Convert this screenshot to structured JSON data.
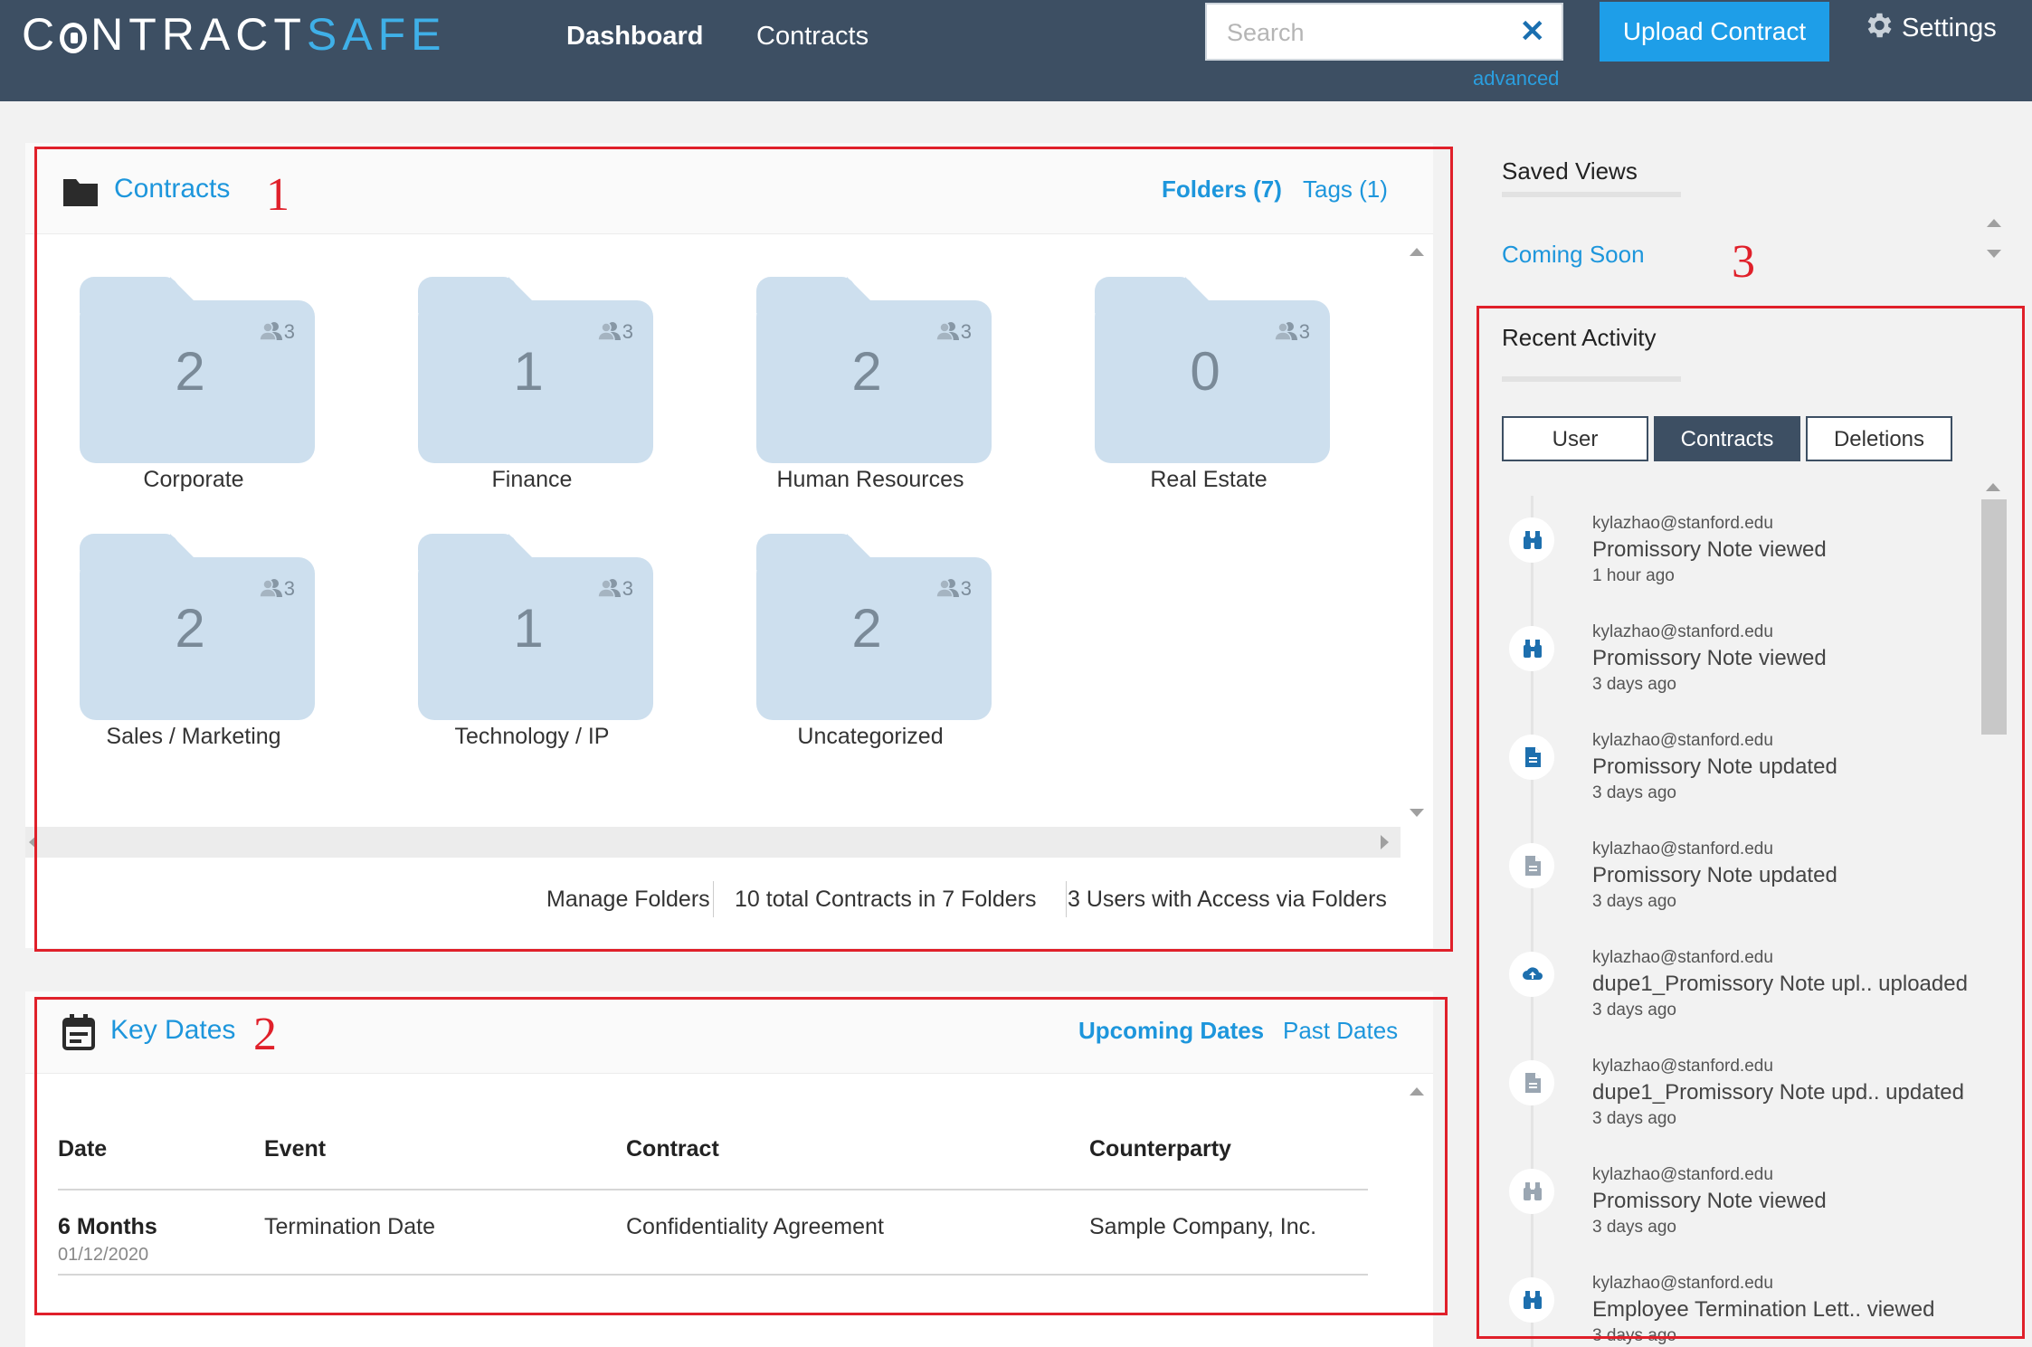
{
  "header": {
    "logo_main": "C NTRACT",
    "logo_accent": "SAFE",
    "nav": [
      "Dashboard",
      "Contracts"
    ],
    "search_placeholder": "Search",
    "search_clear": "✕",
    "advanced_link": "advanced",
    "upload_button": "Upload Contract",
    "settings": "Settings"
  },
  "annotations": [
    "1",
    "2",
    "3"
  ],
  "contracts_panel": {
    "title": "Contracts",
    "folders_tab": "Folders (7)",
    "tags_tab": "Tags (1)",
    "folders": [
      {
        "name": "Corporate",
        "count": "2",
        "users": "3"
      },
      {
        "name": "Finance",
        "count": "1",
        "users": "3"
      },
      {
        "name": "Human Resources",
        "count": "2",
        "users": "3"
      },
      {
        "name": "Real Estate",
        "count": "0",
        "users": "3"
      },
      {
        "name": "Sales / Marketing",
        "count": "2",
        "users": "3"
      },
      {
        "name": "Technology / IP",
        "count": "1",
        "users": "3"
      },
      {
        "name": "Uncategorized",
        "count": "2",
        "users": "3"
      }
    ],
    "footer": {
      "manage_folders": "Manage Folders",
      "total_contracts": "10 total Contracts in 7 Folders",
      "users_access": "3 Users with Access via Folders"
    }
  },
  "key_dates_panel": {
    "title": "Key Dates",
    "upcoming_tab": "Upcoming Dates",
    "past_tab": "Past Dates",
    "columns": [
      "Date",
      "Event",
      "Contract",
      "Counterparty"
    ],
    "rows": [
      {
        "date": "6 Months",
        "date_sub": "01/12/2020",
        "event": "Termination Date",
        "contract": "Confidentiality Agreement",
        "counterparty": "Sample Company, Inc."
      }
    ]
  },
  "sidebar": {
    "saved_views_title": "Saved Views",
    "coming_soon": "Coming Soon",
    "recent_activity_title": "Recent Activity",
    "tabs": [
      "User",
      "Contracts",
      "Deletions"
    ],
    "active_tab": "Contracts",
    "activity": [
      {
        "icon": "binoculars-icon",
        "user": "kylazhao@stanford.edu",
        "message": "Promissory Note viewed",
        "time": "1 hour ago"
      },
      {
        "icon": "binoculars-icon",
        "user": "kylazhao@stanford.edu",
        "message": "Promissory Note viewed",
        "time": "3 days ago"
      },
      {
        "icon": "document-icon",
        "user": "kylazhao@stanford.edu",
        "message": "Promissory Note updated",
        "time": "3 days ago"
      },
      {
        "icon": "document-icon",
        "user": "kylazhao@stanford.edu",
        "message": "Promissory Note updated",
        "time": "3 days ago"
      },
      {
        "icon": "cloud-upload-icon",
        "user": "kylazhao@stanford.edu",
        "message": "dupe1_Promissory Note upl.. uploaded",
        "time": "3 days ago"
      },
      {
        "icon": "document-icon",
        "user": "kylazhao@stanford.edu",
        "message": "dupe1_Promissory Note upd.. updated",
        "time": "3 days ago"
      },
      {
        "icon": "binoculars-icon",
        "user": "kylazhao@stanford.edu",
        "message": "Promissory Note viewed",
        "time": "3 days ago"
      },
      {
        "icon": "binoculars-icon",
        "user": "kylazhao@stanford.edu",
        "message": "Employee Termination Lett.. viewed",
        "time": "3 days ago"
      }
    ]
  },
  "colors": {
    "header_bg": "#3d4f63",
    "accent_blue": "#1d96dc",
    "upload_button": "#1e9ee8",
    "folder_fill": "#cddfee",
    "annotation_red": "#e0202a"
  }
}
